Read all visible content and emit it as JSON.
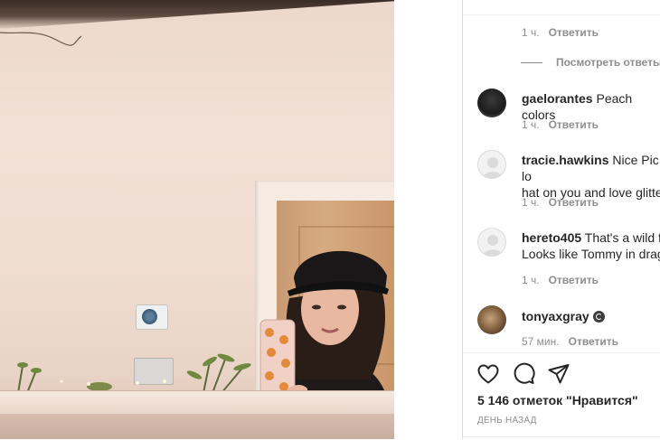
{
  "comments_panel": {
    "top_comment": {
      "time": "1 ч.",
      "reply_label": "Ответить"
    },
    "view_replies_label": "Посмотреть ответы (",
    "comments": [
      {
        "username": "gaelorantes",
        "text": "Peach colors",
        "time": "1 ч.",
        "reply_label": "Ответить",
        "avatar": "user-photo-avatar"
      },
      {
        "username": "tracie.hawkins",
        "text": "Nice Pic! lo",
        "text2": "hat on you and love glitte",
        "time": "1 ч.",
        "reply_label": "Ответить",
        "avatar": "default-avatar"
      },
      {
        "username": "hereto405",
        "text": "That's a wild fi",
        "text2": "Looks like Tommy in drag",
        "time": "1 ч.",
        "reply_label": "Ответить",
        "avatar": "default-avatar"
      },
      {
        "username": "tonyaxgray",
        "text": "",
        "time": "57 мин.",
        "reply_label": "Ответить",
        "avatar": "user-photo-avatar",
        "badge": "verified-icon"
      }
    ]
  },
  "actions": {
    "icons": [
      "heart-icon",
      "comment-icon",
      "share-icon"
    ],
    "likes_label": "5 146 отметок \"Нравится\"",
    "posted_ago": "ДЕНЬ НАЗАД"
  },
  "colors": {
    "text": "#262626",
    "secondary": "#8e8e8e",
    "divider": "#efefef"
  }
}
